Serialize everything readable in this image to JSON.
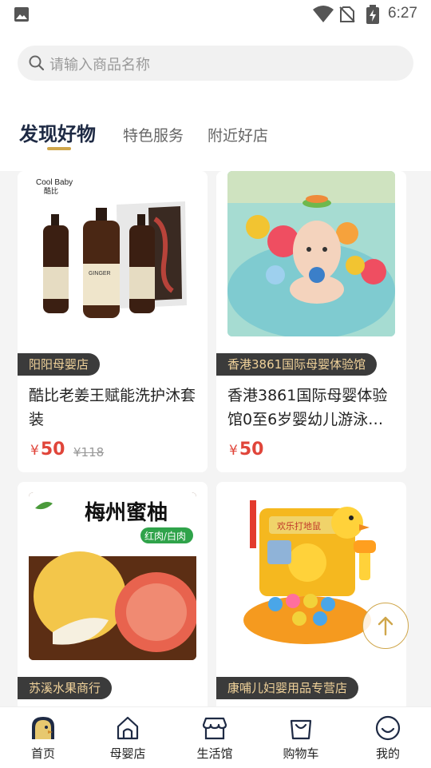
{
  "status_bar": {
    "time": "6:27",
    "icons": [
      "image-icon",
      "wifi-icon",
      "no-sim-icon",
      "battery-charging-icon"
    ]
  },
  "search": {
    "placeholder": "请输入商品名称",
    "icon": "search-icon"
  },
  "tabs": [
    {
      "label": "发现好物",
      "active": true
    },
    {
      "label": "特色服务",
      "active": false
    },
    {
      "label": "附近好店",
      "active": false
    }
  ],
  "products": [
    {
      "shop": "阳阳母婴店",
      "title": "酷比老姜王赋能洗护沐套装",
      "currency": "¥",
      "price": "50",
      "original_price": "¥118",
      "image_text": [
        "Cool Baby",
        "酷比"
      ]
    },
    {
      "shop": "香港3861国际母婴体验馆",
      "title": "香港3861国际母婴体验馆0至6岁婴幼儿游泳…",
      "currency": "¥",
      "price": "50",
      "original_price": ""
    },
    {
      "shop": "苏溪水果商行",
      "title": "",
      "image_text": [
        "梅州蜜柚",
        "红肉/白肉"
      ]
    },
    {
      "shop": "康哺儿妇婴用品专营店",
      "title": "",
      "image_text": [
        "欢乐打地鼠"
      ]
    }
  ],
  "bottom_nav": [
    {
      "label": "首页",
      "icon": "home-duck-icon",
      "active": true
    },
    {
      "label": "母婴店",
      "icon": "house-icon",
      "active": false
    },
    {
      "label": "生活馆",
      "icon": "shop-awning-icon",
      "active": false
    },
    {
      "label": "购物车",
      "icon": "shopping-bag-icon",
      "active": false
    },
    {
      "label": "我的",
      "icon": "smiley-icon",
      "active": false
    }
  ],
  "colors": {
    "accent": "#cfa64a",
    "price": "#e0453a",
    "tab_active": "#1e2a44",
    "badge_bg": "#3b3b3b",
    "badge_text": "#f0d29a"
  }
}
